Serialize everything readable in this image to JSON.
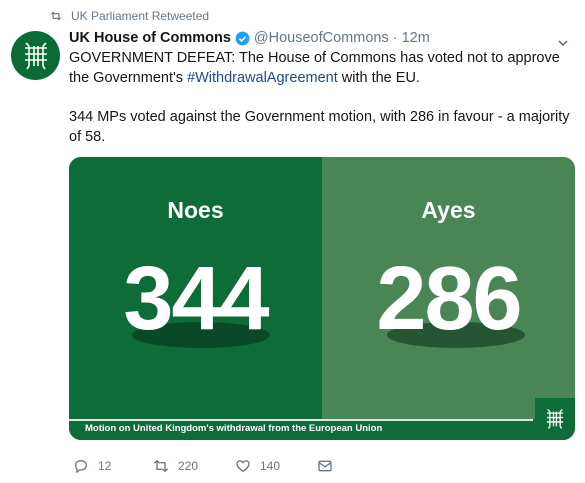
{
  "retweet_context": {
    "text": "UK Parliament Retweeted"
  },
  "tweet": {
    "author_name": "UK House of Commons",
    "author_handle": "@HouseofCommons",
    "separator": "·",
    "time": "12m",
    "text_line1_a": "GOVERNMENT DEFEAT: The House of Commons has voted not to approve the Government's ",
    "hashtag": "#WithdrawalAgreement",
    "text_line1_b": " with the EU.",
    "text_paragraph2": "344 MPs voted against the Government motion, with 286 in favour - a majority of 58."
  },
  "card": {
    "noes_label": "Noes",
    "noes_count": "344",
    "ayes_label": "Ayes",
    "ayes_count": "286",
    "footer": "Motion on United Kingdom's withdrawal from the European Union",
    "colors": {
      "noes_bg": "#0d6c37",
      "ayes_bg": "#4a8655"
    }
  },
  "actions": {
    "reply_count": "12",
    "retweet_count": "220",
    "like_count": "140"
  },
  "icons": [
    "retweet-icon",
    "avatar-portcullis-icon",
    "verified-badge-icon",
    "chevron-down-icon",
    "portcullis-logo-icon",
    "reply-icon",
    "like-icon",
    "direct-message-icon"
  ]
}
